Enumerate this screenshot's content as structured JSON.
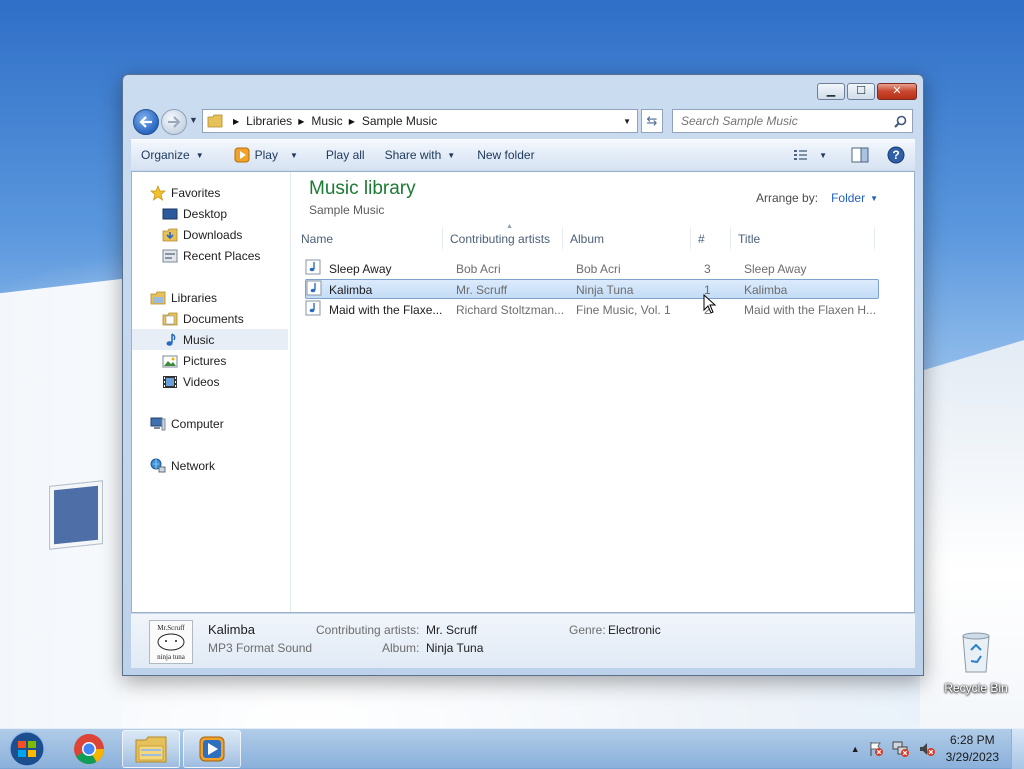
{
  "window": {
    "caption": {
      "minimize": "▁",
      "maximize": "☐",
      "close": "✕"
    },
    "address": {
      "crumbs": [
        "Libraries",
        "Music",
        "Sample Music"
      ]
    },
    "search": {
      "placeholder": "Search Sample Music"
    }
  },
  "toolbar": {
    "organize": "Organize",
    "play": "Play",
    "play_all": "Play all",
    "share_with": "Share with",
    "new_folder": "New folder"
  },
  "navpane": {
    "favorites": "Favorites",
    "desktop": "Desktop",
    "downloads": "Downloads",
    "recent_places": "Recent Places",
    "libraries": "Libraries",
    "documents": "Documents",
    "music": "Music",
    "pictures": "Pictures",
    "videos": "Videos",
    "computer": "Computer",
    "network": "Network"
  },
  "main": {
    "title": "Music library",
    "subtitle": "Sample Music",
    "arrange_label": "Arrange by:",
    "arrange_value": "Folder",
    "columns": {
      "name": "Name",
      "artists": "Contributing artists",
      "album": "Album",
      "number": "#",
      "title": "Title"
    },
    "rows": [
      {
        "name": "Sleep Away",
        "artists": "Bob Acri",
        "album": "Bob Acri",
        "number": "3",
        "title": "Sleep Away"
      },
      {
        "name": "Kalimba",
        "artists": "Mr. Scruff",
        "album": "Ninja Tuna",
        "number": "1",
        "title": "Kalimba"
      },
      {
        "name": "Maid with the Flaxe...",
        "artists": "Richard Stoltzman...",
        "album": "Fine Music, Vol. 1",
        "number": "2",
        "title": "Maid with the Flaxen H..."
      }
    ]
  },
  "details": {
    "thumb_text_top": "Mr.Scruff",
    "thumb_text_bottom": "ninja tuna",
    "name": "Kalimba",
    "type": "MP3 Format Sound",
    "artists_label": "Contributing artists:",
    "artists_value": "Mr. Scruff",
    "album_label": "Album:",
    "album_value": "Ninja Tuna",
    "genre_label": "Genre:",
    "genre_value": "Electronic"
  },
  "desktop": {
    "recycle_bin": "Recycle Bin"
  },
  "taskbar": {
    "time": "6:28 PM",
    "date": "3/29/2023"
  },
  "colors": {
    "library_title": "#1b7a33",
    "link": "#1f5fbf",
    "selection": "#c4dcf6"
  }
}
